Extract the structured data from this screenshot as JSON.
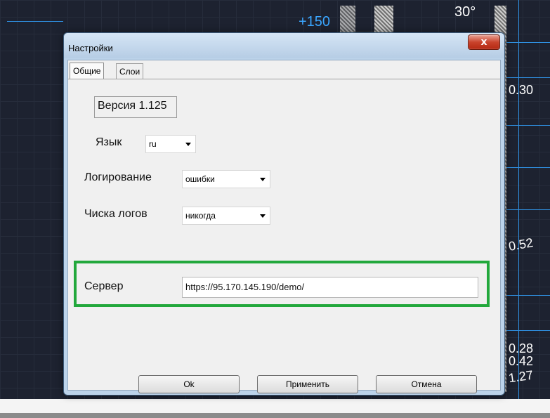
{
  "background": {
    "texts": {
      "plus150": "+150",
      "angle": "30°",
      "v030": "0.30",
      "v052": "0.52",
      "v028": "0.28",
      "v042": "0.42",
      "v127": "1.27"
    },
    "colors": {
      "canvas": "#1d2230",
      "accent": "#3aa6ff"
    }
  },
  "dialog": {
    "title": "Настройки",
    "close_icon": "close-icon",
    "tabs": [
      {
        "label": "Общие",
        "active": true
      },
      {
        "label": "Слои",
        "active": false
      }
    ],
    "version": "Версия 1.125",
    "language": {
      "label": "Язык",
      "value": "ru"
    },
    "logging": {
      "label": "Логирование",
      "value": "ошибки"
    },
    "log_cleanup": {
      "label": "Чиска логов",
      "value": "никогда"
    },
    "server": {
      "label": "Сервер",
      "value": "https://95.170.145.190/demo/"
    },
    "buttons": {
      "ok": "Ok",
      "apply": "Применить",
      "cancel": "Отмена"
    },
    "highlight_color": "#22a83c"
  }
}
